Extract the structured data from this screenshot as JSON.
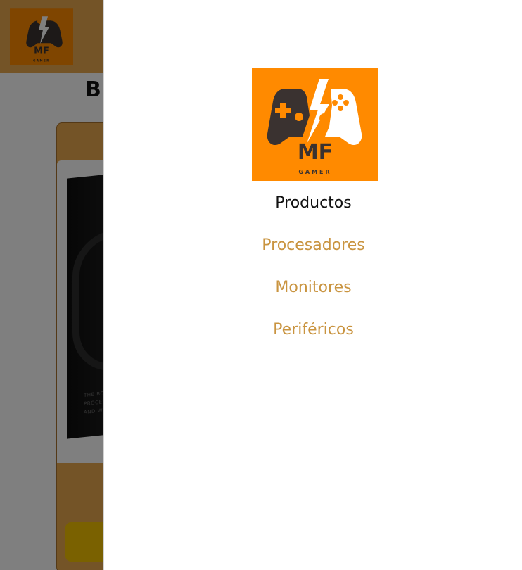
{
  "colors": {
    "brand_orange": "#ff8a00",
    "header_bg": "#e9a84e",
    "link_color": "#c99440",
    "title_link_color": "#111111",
    "cart_button": "#f5c300",
    "overlay": "rgba(0,0,0,0.5)"
  },
  "logo": {
    "big_text": "MF",
    "small_text": "GAMER",
    "icon": "gamepad-lightning-logo"
  },
  "background_page": {
    "title": "Bl",
    "box_text": "THE BOX\nPROCESS\nAND WE"
  },
  "menu": {
    "title": "Productos",
    "items": [
      {
        "label": "Procesadores"
      },
      {
        "label": "Monitores"
      },
      {
        "label": "Periféricos"
      }
    ]
  }
}
